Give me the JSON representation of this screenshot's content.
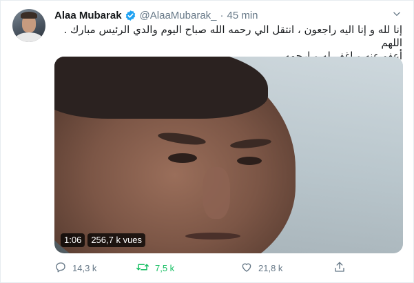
{
  "tweet": {
    "author_name": "Alaa Mubarak",
    "handle": "@AlaaMubarak_",
    "separator": "·",
    "time": "45 min",
    "text_line1": "إنا لله و إنا اليه راجعون ، انتقل الي رحمه الله صباح اليوم والدي الرئيس مبارك . اللهم",
    "text_line2": "أعفو عنه و اغفر له و ارحمه ."
  },
  "media": {
    "duration": "1:06",
    "views": "256,7 k vues"
  },
  "actions": {
    "reply_count": "14,3 k",
    "retweet_count": "7,5 k",
    "like_count": "21,8 k"
  },
  "colors": {
    "verified_blue": "#1da1f2",
    "retweet_green": "#17bf63",
    "muted_gray": "#657786"
  },
  "icons": {
    "verified": "verified-badge-icon",
    "caret": "chevron-down-icon",
    "reply": "reply-icon",
    "retweet": "retweet-icon",
    "like": "heart-icon",
    "share": "share-icon"
  }
}
